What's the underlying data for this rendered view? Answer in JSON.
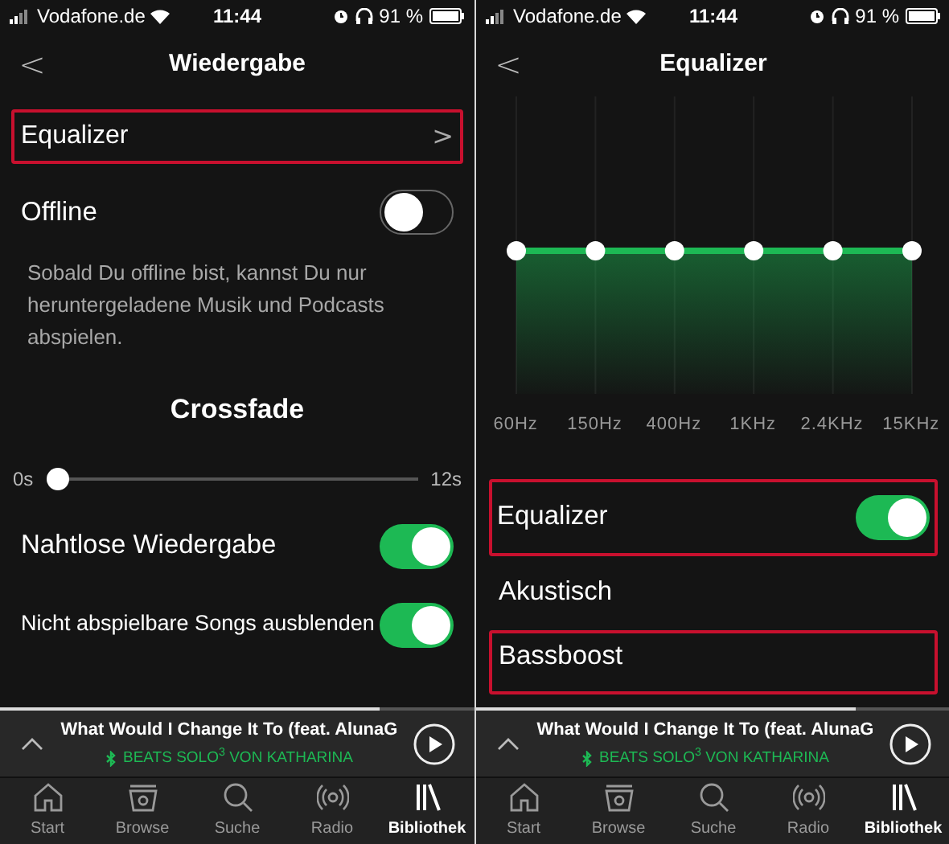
{
  "screens": [
    {
      "status_bar": {
        "carrier": "Vodafone.de",
        "time": "11:44",
        "battery": "91 %"
      },
      "header": {
        "back": "<",
        "title": "Wiedergabe"
      },
      "items": [
        {
          "kind": "link",
          "label": "Equalizer",
          "chevron": ">",
          "highlighted": true
        },
        {
          "kind": "toggle",
          "label": "Offline",
          "on": false,
          "highlighted": false
        },
        {
          "kind": "text",
          "text": "Sobald Du offline bist, kannst Du nur heruntergeladene Musik und Podcasts abspielen."
        },
        {
          "kind": "heading",
          "text": "Crossfade"
        },
        {
          "kind": "slider",
          "min_label": "0s",
          "max_label": "12s",
          "level": 0
        },
        {
          "kind": "toggle",
          "label": "Nahtlose Wiedergabe",
          "on": true,
          "highlighted": false
        },
        {
          "kind": "toggle",
          "label": "Nicht abspielbare Songs ausblenden",
          "on": true,
          "highlighted": false
        }
      ],
      "player": {
        "title": "What Would I Change It To (feat. AlunaG",
        "device": "BEATS SOLO$^{3}$ VON KATHARINA",
        "level": 0.8
      },
      "tabs": [
        {
          "label": "Start",
          "selected": false
        },
        {
          "label": "Browse",
          "selected": false
        },
        {
          "label": "Suche",
          "selected": false
        },
        {
          "label": "Radio",
          "selected": false
        },
        {
          "label": "Bibliothek",
          "selected": true
        }
      ]
    },
    {
      "status_bar": {
        "carrier": "Vodafone.de",
        "time": "11:44",
        "battery": "91 %"
      },
      "header": {
        "back": "<",
        "title": "Equalizer"
      },
      "items": [
        {
          "kind": "equalizer",
          "bands": [
            {
              "label": "60Hz"
            },
            {
              "label": "150Hz"
            },
            {
              "label": "400Hz"
            },
            {
              "label": "1KHz"
            },
            {
              "label": "2.4KHz"
            },
            {
              "label": "15KHz"
            }
          ]
        },
        {
          "kind": "toggle",
          "label": "Equalizer",
          "on": true,
          "highlighted": true
        },
        {
          "kind": "option",
          "label": "Akustisch",
          "highlighted": false
        },
        {
          "kind": "option",
          "label": "Bassboost",
          "highlighted": true
        }
      ],
      "player": {
        "title": "What Would I Change It To (feat. AlunaG",
        "device": "BEATS SOLO$^{3}$ VON KATHARINA",
        "level": 0.8
      },
      "tabs": [
        {
          "label": "Start",
          "selected": false
        },
        {
          "label": "Browse",
          "selected": false
        },
        {
          "label": "Suche",
          "selected": false
        },
        {
          "label": "Radio",
          "selected": false
        },
        {
          "label": "Bibliothek",
          "selected": true
        }
      ]
    }
  ]
}
